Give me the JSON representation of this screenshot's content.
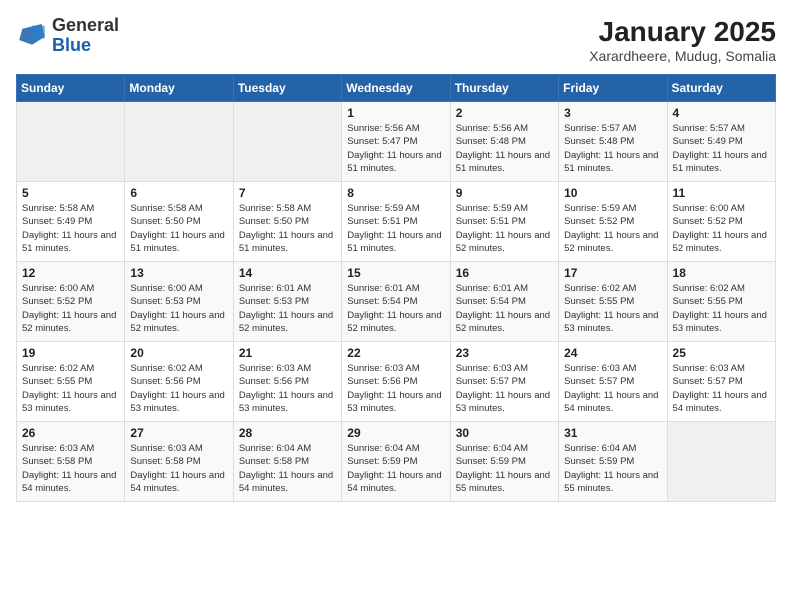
{
  "header": {
    "logo_general": "General",
    "logo_blue": "Blue",
    "title": "January 2025",
    "subtitle": "Xarardheere, Mudug, Somalia"
  },
  "weekdays": [
    "Sunday",
    "Monday",
    "Tuesday",
    "Wednesday",
    "Thursday",
    "Friday",
    "Saturday"
  ],
  "weeks": [
    [
      {
        "day": "",
        "sunrise": "",
        "sunset": "",
        "daylight": "",
        "empty": true
      },
      {
        "day": "",
        "sunrise": "",
        "sunset": "",
        "daylight": "",
        "empty": true
      },
      {
        "day": "",
        "sunrise": "",
        "sunset": "",
        "daylight": "",
        "empty": true
      },
      {
        "day": "1",
        "sunrise": "Sunrise: 5:56 AM",
        "sunset": "Sunset: 5:47 PM",
        "daylight": "Daylight: 11 hours and 51 minutes.",
        "empty": false
      },
      {
        "day": "2",
        "sunrise": "Sunrise: 5:56 AM",
        "sunset": "Sunset: 5:48 PM",
        "daylight": "Daylight: 11 hours and 51 minutes.",
        "empty": false
      },
      {
        "day": "3",
        "sunrise": "Sunrise: 5:57 AM",
        "sunset": "Sunset: 5:48 PM",
        "daylight": "Daylight: 11 hours and 51 minutes.",
        "empty": false
      },
      {
        "day": "4",
        "sunrise": "Sunrise: 5:57 AM",
        "sunset": "Sunset: 5:49 PM",
        "daylight": "Daylight: 11 hours and 51 minutes.",
        "empty": false
      }
    ],
    [
      {
        "day": "5",
        "sunrise": "Sunrise: 5:58 AM",
        "sunset": "Sunset: 5:49 PM",
        "daylight": "Daylight: 11 hours and 51 minutes.",
        "empty": false
      },
      {
        "day": "6",
        "sunrise": "Sunrise: 5:58 AM",
        "sunset": "Sunset: 5:50 PM",
        "daylight": "Daylight: 11 hours and 51 minutes.",
        "empty": false
      },
      {
        "day": "7",
        "sunrise": "Sunrise: 5:58 AM",
        "sunset": "Sunset: 5:50 PM",
        "daylight": "Daylight: 11 hours and 51 minutes.",
        "empty": false
      },
      {
        "day": "8",
        "sunrise": "Sunrise: 5:59 AM",
        "sunset": "Sunset: 5:51 PM",
        "daylight": "Daylight: 11 hours and 51 minutes.",
        "empty": false
      },
      {
        "day": "9",
        "sunrise": "Sunrise: 5:59 AM",
        "sunset": "Sunset: 5:51 PM",
        "daylight": "Daylight: 11 hours and 52 minutes.",
        "empty": false
      },
      {
        "day": "10",
        "sunrise": "Sunrise: 5:59 AM",
        "sunset": "Sunset: 5:52 PM",
        "daylight": "Daylight: 11 hours and 52 minutes.",
        "empty": false
      },
      {
        "day": "11",
        "sunrise": "Sunrise: 6:00 AM",
        "sunset": "Sunset: 5:52 PM",
        "daylight": "Daylight: 11 hours and 52 minutes.",
        "empty": false
      }
    ],
    [
      {
        "day": "12",
        "sunrise": "Sunrise: 6:00 AM",
        "sunset": "Sunset: 5:52 PM",
        "daylight": "Daylight: 11 hours and 52 minutes.",
        "empty": false
      },
      {
        "day": "13",
        "sunrise": "Sunrise: 6:00 AM",
        "sunset": "Sunset: 5:53 PM",
        "daylight": "Daylight: 11 hours and 52 minutes.",
        "empty": false
      },
      {
        "day": "14",
        "sunrise": "Sunrise: 6:01 AM",
        "sunset": "Sunset: 5:53 PM",
        "daylight": "Daylight: 11 hours and 52 minutes.",
        "empty": false
      },
      {
        "day": "15",
        "sunrise": "Sunrise: 6:01 AM",
        "sunset": "Sunset: 5:54 PM",
        "daylight": "Daylight: 11 hours and 52 minutes.",
        "empty": false
      },
      {
        "day": "16",
        "sunrise": "Sunrise: 6:01 AM",
        "sunset": "Sunset: 5:54 PM",
        "daylight": "Daylight: 11 hours and 52 minutes.",
        "empty": false
      },
      {
        "day": "17",
        "sunrise": "Sunrise: 6:02 AM",
        "sunset": "Sunset: 5:55 PM",
        "daylight": "Daylight: 11 hours and 53 minutes.",
        "empty": false
      },
      {
        "day": "18",
        "sunrise": "Sunrise: 6:02 AM",
        "sunset": "Sunset: 5:55 PM",
        "daylight": "Daylight: 11 hours and 53 minutes.",
        "empty": false
      }
    ],
    [
      {
        "day": "19",
        "sunrise": "Sunrise: 6:02 AM",
        "sunset": "Sunset: 5:55 PM",
        "daylight": "Daylight: 11 hours and 53 minutes.",
        "empty": false
      },
      {
        "day": "20",
        "sunrise": "Sunrise: 6:02 AM",
        "sunset": "Sunset: 5:56 PM",
        "daylight": "Daylight: 11 hours and 53 minutes.",
        "empty": false
      },
      {
        "day": "21",
        "sunrise": "Sunrise: 6:03 AM",
        "sunset": "Sunset: 5:56 PM",
        "daylight": "Daylight: 11 hours and 53 minutes.",
        "empty": false
      },
      {
        "day": "22",
        "sunrise": "Sunrise: 6:03 AM",
        "sunset": "Sunset: 5:56 PM",
        "daylight": "Daylight: 11 hours and 53 minutes.",
        "empty": false
      },
      {
        "day": "23",
        "sunrise": "Sunrise: 6:03 AM",
        "sunset": "Sunset: 5:57 PM",
        "daylight": "Daylight: 11 hours and 53 minutes.",
        "empty": false
      },
      {
        "day": "24",
        "sunrise": "Sunrise: 6:03 AM",
        "sunset": "Sunset: 5:57 PM",
        "daylight": "Daylight: 11 hours and 54 minutes.",
        "empty": false
      },
      {
        "day": "25",
        "sunrise": "Sunrise: 6:03 AM",
        "sunset": "Sunset: 5:57 PM",
        "daylight": "Daylight: 11 hours and 54 minutes.",
        "empty": false
      }
    ],
    [
      {
        "day": "26",
        "sunrise": "Sunrise: 6:03 AM",
        "sunset": "Sunset: 5:58 PM",
        "daylight": "Daylight: 11 hours and 54 minutes.",
        "empty": false
      },
      {
        "day": "27",
        "sunrise": "Sunrise: 6:03 AM",
        "sunset": "Sunset: 5:58 PM",
        "daylight": "Daylight: 11 hours and 54 minutes.",
        "empty": false
      },
      {
        "day": "28",
        "sunrise": "Sunrise: 6:04 AM",
        "sunset": "Sunset: 5:58 PM",
        "daylight": "Daylight: 11 hours and 54 minutes.",
        "empty": false
      },
      {
        "day": "29",
        "sunrise": "Sunrise: 6:04 AM",
        "sunset": "Sunset: 5:59 PM",
        "daylight": "Daylight: 11 hours and 54 minutes.",
        "empty": false
      },
      {
        "day": "30",
        "sunrise": "Sunrise: 6:04 AM",
        "sunset": "Sunset: 5:59 PM",
        "daylight": "Daylight: 11 hours and 55 minutes.",
        "empty": false
      },
      {
        "day": "31",
        "sunrise": "Sunrise: 6:04 AM",
        "sunset": "Sunset: 5:59 PM",
        "daylight": "Daylight: 11 hours and 55 minutes.",
        "empty": false
      },
      {
        "day": "",
        "sunrise": "",
        "sunset": "",
        "daylight": "",
        "empty": true
      }
    ]
  ]
}
